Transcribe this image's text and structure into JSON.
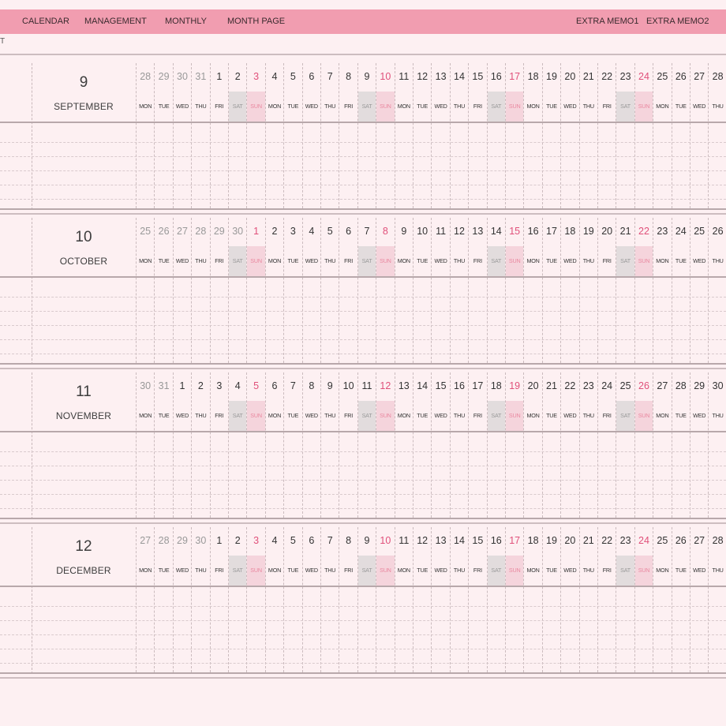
{
  "nav": {
    "calendar": "CALENDAR",
    "management": "MANAGEMENT",
    "monthly": "MONTHLY",
    "month_page": "MONTH PAGE",
    "extra_memo1": "EXTRA MEMO1",
    "extra_memo2": "EXTRA MEMO2"
  },
  "left_marker": "T",
  "colors": {
    "topbar": "#f19db0",
    "background": "#fdf0f2",
    "sunday_text": "#e0507a",
    "saturday_shade": "#e2dcdd",
    "sunday_shade": "#f5d4dc"
  },
  "months": [
    {
      "number": "9",
      "name": "SEPTEMBER",
      "days": [
        {
          "d": "28",
          "dow": "MON",
          "prev": true
        },
        {
          "d": "29",
          "dow": "TUE",
          "prev": true
        },
        {
          "d": "30",
          "dow": "WED",
          "prev": true
        },
        {
          "d": "31",
          "dow": "THU",
          "prev": true
        },
        {
          "d": "1",
          "dow": "FRI"
        },
        {
          "d": "2",
          "dow": "SAT"
        },
        {
          "d": "3",
          "dow": "SUN"
        },
        {
          "d": "4",
          "dow": "MON"
        },
        {
          "d": "5",
          "dow": "TUE"
        },
        {
          "d": "6",
          "dow": "WED"
        },
        {
          "d": "7",
          "dow": "THU"
        },
        {
          "d": "8",
          "dow": "FRI"
        },
        {
          "d": "9",
          "dow": "SAT"
        },
        {
          "d": "10",
          "dow": "SUN"
        },
        {
          "d": "11",
          "dow": "MON"
        },
        {
          "d": "12",
          "dow": "TUE"
        },
        {
          "d": "13",
          "dow": "WED"
        },
        {
          "d": "14",
          "dow": "THU"
        },
        {
          "d": "15",
          "dow": "FRI"
        },
        {
          "d": "16",
          "dow": "SAT"
        },
        {
          "d": "17",
          "dow": "SUN"
        },
        {
          "d": "18",
          "dow": "MON"
        },
        {
          "d": "19",
          "dow": "TUE"
        },
        {
          "d": "20",
          "dow": "WED"
        },
        {
          "d": "21",
          "dow": "THU"
        },
        {
          "d": "22",
          "dow": "FRI"
        },
        {
          "d": "23",
          "dow": "SAT"
        },
        {
          "d": "24",
          "dow": "SUN"
        },
        {
          "d": "25",
          "dow": "MON"
        },
        {
          "d": "26",
          "dow": "TUE"
        },
        {
          "d": "27",
          "dow": "WED"
        },
        {
          "d": "28",
          "dow": "THU"
        }
      ]
    },
    {
      "number": "10",
      "name": "OCTOBER",
      "days": [
        {
          "d": "25",
          "dow": "MON",
          "prev": true
        },
        {
          "d": "26",
          "dow": "TUE",
          "prev": true
        },
        {
          "d": "27",
          "dow": "WED",
          "prev": true
        },
        {
          "d": "28",
          "dow": "THU",
          "prev": true
        },
        {
          "d": "29",
          "dow": "FRI",
          "prev": true
        },
        {
          "d": "30",
          "dow": "SAT",
          "prev": true
        },
        {
          "d": "1",
          "dow": "SUN"
        },
        {
          "d": "2",
          "dow": "MON"
        },
        {
          "d": "3",
          "dow": "TUE"
        },
        {
          "d": "4",
          "dow": "WED"
        },
        {
          "d": "5",
          "dow": "THU"
        },
        {
          "d": "6",
          "dow": "FRI"
        },
        {
          "d": "7",
          "dow": "SAT"
        },
        {
          "d": "8",
          "dow": "SUN"
        },
        {
          "d": "9",
          "dow": "MON"
        },
        {
          "d": "10",
          "dow": "TUE"
        },
        {
          "d": "11",
          "dow": "WED"
        },
        {
          "d": "12",
          "dow": "THU"
        },
        {
          "d": "13",
          "dow": "FRI"
        },
        {
          "d": "14",
          "dow": "SAT"
        },
        {
          "d": "15",
          "dow": "SUN"
        },
        {
          "d": "16",
          "dow": "MON"
        },
        {
          "d": "17",
          "dow": "TUE"
        },
        {
          "d": "18",
          "dow": "WED"
        },
        {
          "d": "19",
          "dow": "THU"
        },
        {
          "d": "20",
          "dow": "FRI"
        },
        {
          "d": "21",
          "dow": "SAT"
        },
        {
          "d": "22",
          "dow": "SUN"
        },
        {
          "d": "23",
          "dow": "MON"
        },
        {
          "d": "24",
          "dow": "TUE"
        },
        {
          "d": "25",
          "dow": "WED"
        },
        {
          "d": "26",
          "dow": "THU"
        }
      ]
    },
    {
      "number": "11",
      "name": "NOVEMBER",
      "days": [
        {
          "d": "30",
          "dow": "MON",
          "prev": true
        },
        {
          "d": "31",
          "dow": "TUE",
          "prev": true
        },
        {
          "d": "1",
          "dow": "WED"
        },
        {
          "d": "2",
          "dow": "THU"
        },
        {
          "d": "3",
          "dow": "FRI"
        },
        {
          "d": "4",
          "dow": "SAT"
        },
        {
          "d": "5",
          "dow": "SUN"
        },
        {
          "d": "6",
          "dow": "MON"
        },
        {
          "d": "7",
          "dow": "TUE"
        },
        {
          "d": "8",
          "dow": "WED"
        },
        {
          "d": "9",
          "dow": "THU"
        },
        {
          "d": "10",
          "dow": "FRI"
        },
        {
          "d": "11",
          "dow": "SAT"
        },
        {
          "d": "12",
          "dow": "SUN"
        },
        {
          "d": "13",
          "dow": "MON"
        },
        {
          "d": "14",
          "dow": "TUE"
        },
        {
          "d": "15",
          "dow": "WED"
        },
        {
          "d": "16",
          "dow": "THU"
        },
        {
          "d": "17",
          "dow": "FRI"
        },
        {
          "d": "18",
          "dow": "SAT"
        },
        {
          "d": "19",
          "dow": "SUN"
        },
        {
          "d": "20",
          "dow": "MON"
        },
        {
          "d": "21",
          "dow": "TUE"
        },
        {
          "d": "22",
          "dow": "WED"
        },
        {
          "d": "23",
          "dow": "THU"
        },
        {
          "d": "24",
          "dow": "FRI"
        },
        {
          "d": "25",
          "dow": "SAT"
        },
        {
          "d": "26",
          "dow": "SUN"
        },
        {
          "d": "27",
          "dow": "MON"
        },
        {
          "d": "28",
          "dow": "TUE"
        },
        {
          "d": "29",
          "dow": "WED"
        },
        {
          "d": "30",
          "dow": "THU"
        }
      ]
    },
    {
      "number": "12",
      "name": "DECEMBER",
      "days": [
        {
          "d": "27",
          "dow": "MON",
          "prev": true
        },
        {
          "d": "28",
          "dow": "TUE",
          "prev": true
        },
        {
          "d": "29",
          "dow": "WED",
          "prev": true
        },
        {
          "d": "30",
          "dow": "THU",
          "prev": true
        },
        {
          "d": "1",
          "dow": "FRI"
        },
        {
          "d": "2",
          "dow": "SAT"
        },
        {
          "d": "3",
          "dow": "SUN"
        },
        {
          "d": "4",
          "dow": "MON"
        },
        {
          "d": "5",
          "dow": "TUE"
        },
        {
          "d": "6",
          "dow": "WED"
        },
        {
          "d": "7",
          "dow": "THU"
        },
        {
          "d": "8",
          "dow": "FRI"
        },
        {
          "d": "9",
          "dow": "SAT"
        },
        {
          "d": "10",
          "dow": "SUN"
        },
        {
          "d": "11",
          "dow": "MON"
        },
        {
          "d": "12",
          "dow": "TUE"
        },
        {
          "d": "13",
          "dow": "WED"
        },
        {
          "d": "14",
          "dow": "THU"
        },
        {
          "d": "15",
          "dow": "FRI"
        },
        {
          "d": "16",
          "dow": "SAT"
        },
        {
          "d": "17",
          "dow": "SUN"
        },
        {
          "d": "18",
          "dow": "MON"
        },
        {
          "d": "19",
          "dow": "TUE"
        },
        {
          "d": "20",
          "dow": "WED"
        },
        {
          "d": "21",
          "dow": "THU"
        },
        {
          "d": "22",
          "dow": "FRI"
        },
        {
          "d": "23",
          "dow": "SAT"
        },
        {
          "d": "24",
          "dow": "SUN"
        },
        {
          "d": "25",
          "dow": "MON"
        },
        {
          "d": "26",
          "dow": "TUE"
        },
        {
          "d": "27",
          "dow": "WED"
        },
        {
          "d": "28",
          "dow": "THU"
        }
      ]
    }
  ]
}
